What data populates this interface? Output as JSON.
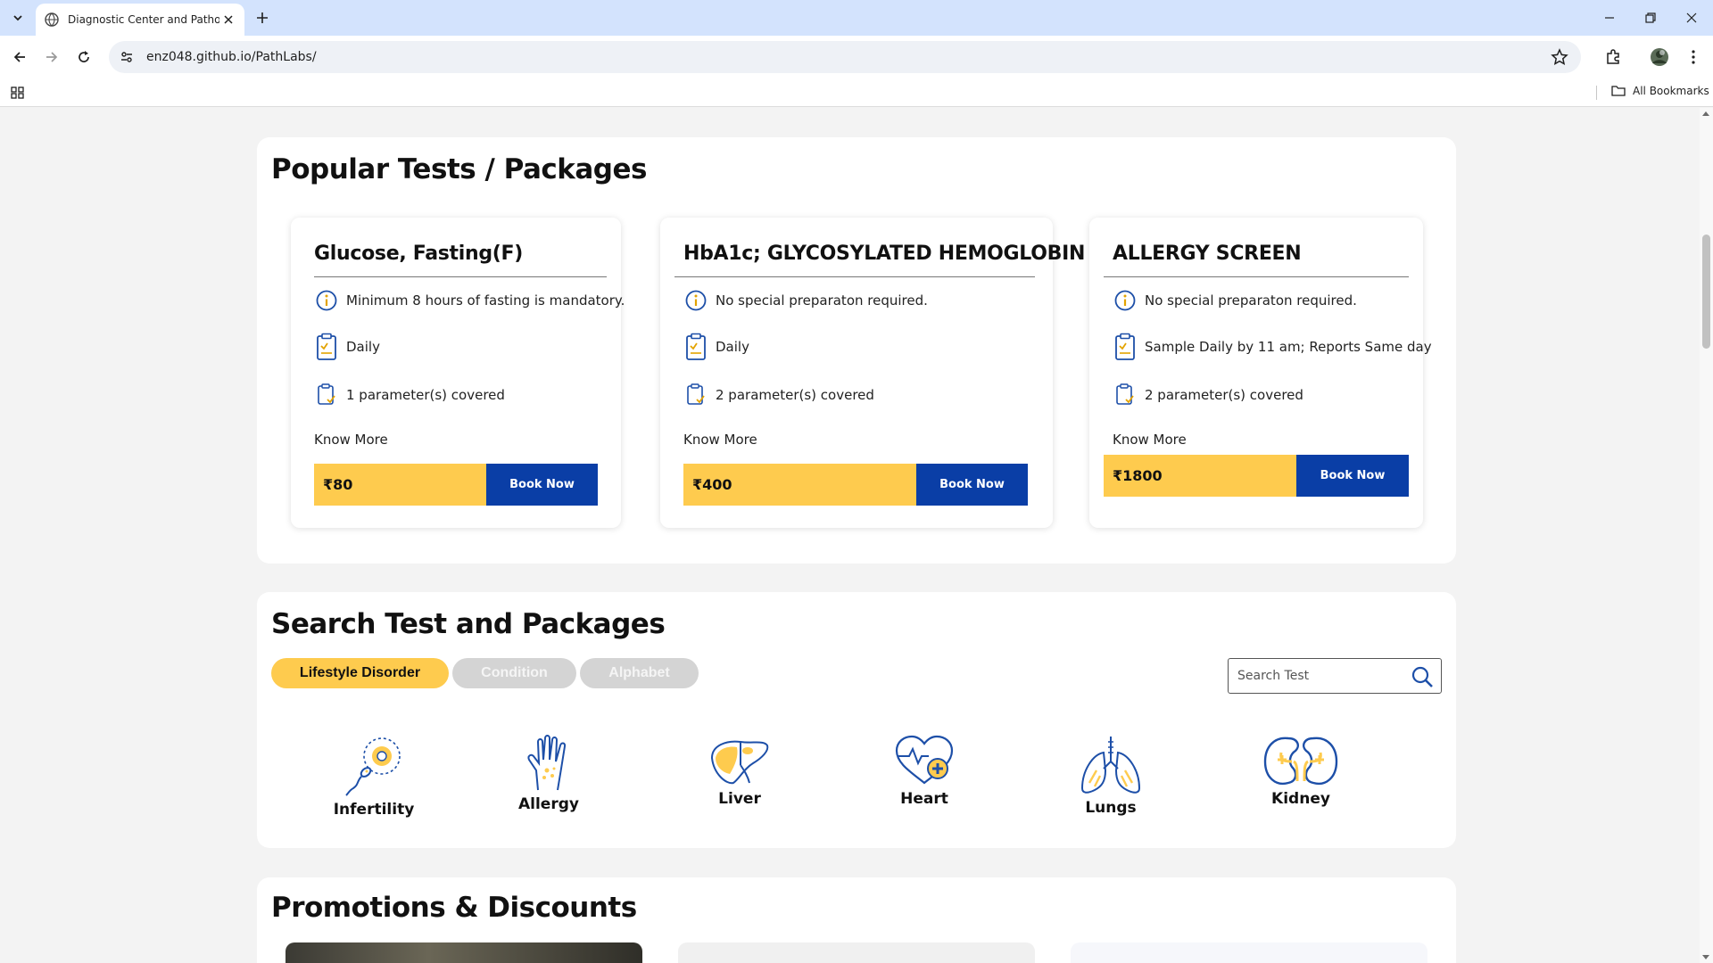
{
  "browser": {
    "tab_title": "Diagnostic Center and Patholo",
    "url": "enz048.github.io/PathLabs/",
    "all_bookmarks": "All Bookmarks"
  },
  "popular": {
    "title": "Popular Tests / Packages",
    "cards": [
      {
        "title": "Glucose, Fasting(F)",
        "info": "Minimum 8 hours of fasting is mandatory.",
        "schedule": "Daily",
        "params": "1 parameter(s) covered",
        "know_more": "Know More",
        "price": "₹80",
        "book": "Book Now"
      },
      {
        "title": "HbA1c; GLYCOSYLATED HEMOGLOBIN",
        "info": "No special preparaton required.",
        "schedule": "Daily",
        "params": "2 parameter(s) covered",
        "know_more": "Know More",
        "price": "₹400",
        "book": "Book Now"
      },
      {
        "title": "ALLERGY SCREEN",
        "info": "No special preparaton required.",
        "schedule": "Sample Daily by 11 am; Reports Same day",
        "params": "2 parameter(s) covered",
        "know_more": "Know More",
        "price": "₹1800",
        "book": "Book Now"
      }
    ]
  },
  "search": {
    "title": "Search Test and Packages",
    "tabs": [
      "Lifestyle Disorder",
      "Condition",
      "Alphabet"
    ],
    "active_tab": "Lifestyle Disorder",
    "placeholder": "Search Test",
    "categories": [
      "Infertility",
      "Allergy",
      "Liver",
      "Heart",
      "Lungs",
      "Kidney"
    ]
  },
  "promotions": {
    "title": "Promotions & Discounts"
  },
  "colors": {
    "accent_yellow": "#fecb4e",
    "accent_blue": "#0a3ea6",
    "icon_blue": "#1d4fa8"
  }
}
